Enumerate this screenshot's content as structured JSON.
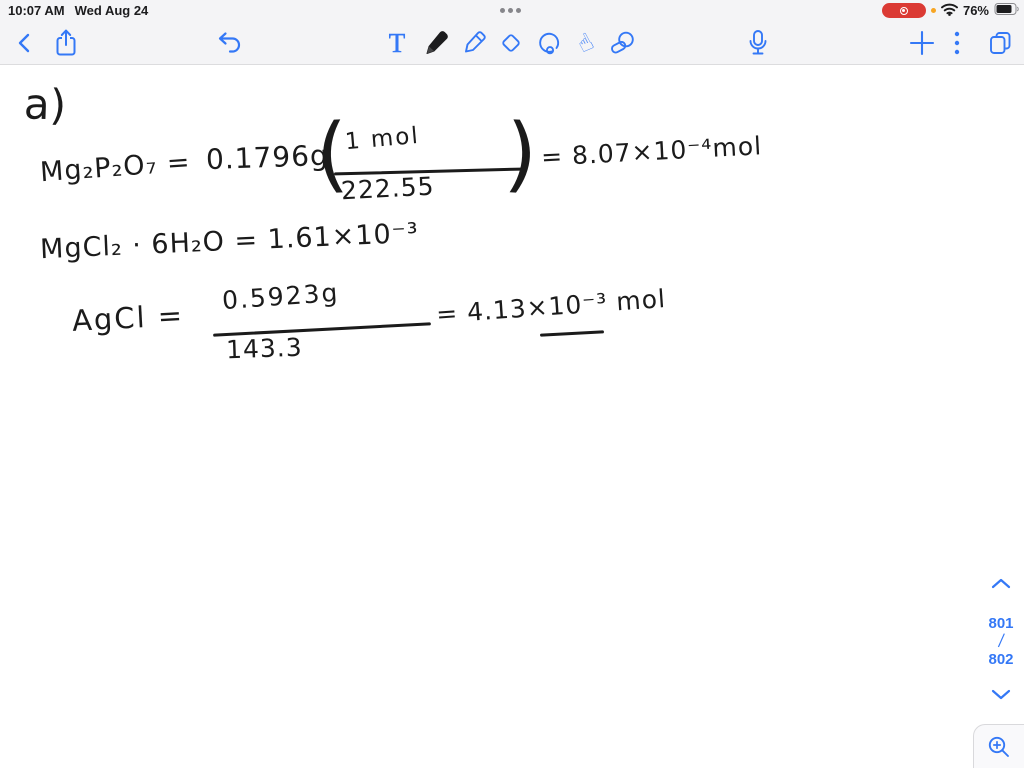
{
  "status_bar": {
    "time": "10:07 AM",
    "date": "Wed Aug 24",
    "battery_percent": "76%",
    "battery_level": 76
  },
  "toolbar": {
    "text_tool_label": "T"
  },
  "handwriting": {
    "part_label": "a)",
    "eq1": {
      "lhs": "Mg₂P₂O₇ =",
      "mass": "0.1796g",
      "open_paren": "(",
      "frac_num": "1 mol",
      "frac_den": "222.55",
      "close_paren": ")",
      "result": "= 8.07×10⁻⁴mol"
    },
    "eq2": "MgCl₂ · 6H₂O = 1.61×10⁻³",
    "eq3": {
      "lhs": "AgCl =",
      "frac_num": "0.5923g",
      "frac_den": "143.3",
      "result": "= 4.13×10⁻³ mol"
    }
  },
  "page_nav": {
    "current_page": "801",
    "page_divider": "/",
    "total_pages": "802"
  },
  "hand_tool_glyph": "☝",
  "icons": {
    "back": "chevron-left",
    "share": "square-with-up-arrow",
    "undo": "curved-undo-arrow",
    "text_tool": "letter-T",
    "pen_tool": "filled-black-pencil",
    "highlighter_tool": "outline-marker",
    "eraser_tool": "diamond",
    "lasso_tool": "loop-with-curl",
    "hand_tool": "pointing-hand",
    "tape_tool": "pen-through-ring",
    "microphone": "mic",
    "add": "plus",
    "more": "vertical-ellipsis",
    "pages": "overlapping-pages",
    "page_up": "chevron-up",
    "page_down": "chevron-down",
    "zoom_in": "magnifier-plus",
    "wifi": "wifi-arcs",
    "battery": "battery-body",
    "screen_recording": "red-record-pill",
    "privacy": "orange-dot",
    "multitask": "three-gray-dots"
  },
  "colors": {
    "accent_blue": "#3478f6",
    "toolbar_bg": "#f4f4f6",
    "separator": "#dcdcde",
    "ink": "#1b1b1b",
    "record_red": "#db3a34",
    "privacy_orange": "#f7a523",
    "canvas_bg": "#ffffff"
  }
}
